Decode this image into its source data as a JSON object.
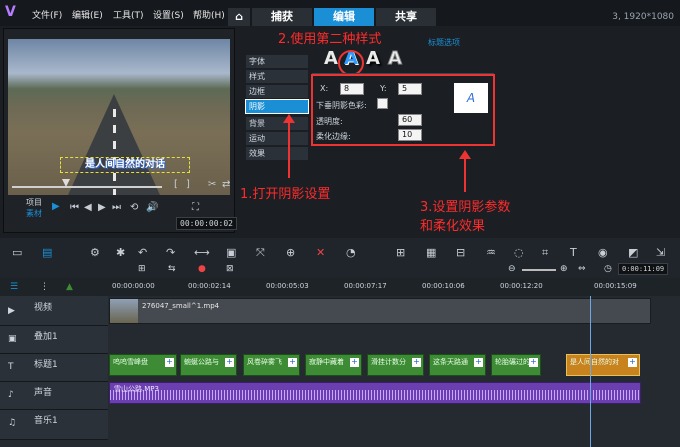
{
  "menu": {
    "items": [
      "文件(F)",
      "编辑(E)",
      "工具(T)",
      "设置(S)",
      "帮助(H)"
    ]
  },
  "tabs": {
    "home": "⌂",
    "capture": "捕获",
    "edit": "编辑",
    "share": "共享"
  },
  "resolution": "3, 1920*1080",
  "preview": {
    "subtitle": "是人间自然的对话",
    "project_label": "项目",
    "clip_label": "素材",
    "timecode": "00:00:00:02"
  },
  "title_options": {
    "header": "标题选项",
    "side_items": [
      "字体",
      "样式",
      "边框",
      "阴影",
      "背景",
      "运动",
      "效果"
    ],
    "active_item": "阴影",
    "x_label": "X:",
    "x_value": "8",
    "y_label": "Y:",
    "y_value": "5",
    "shadow_color_label": "下垂阴影色彩:",
    "opacity_label": "透明度:",
    "opacity_value": "60",
    "soft_edge_label": "柔化边缘:",
    "soft_edge_value": "10",
    "style_glyph": "A"
  },
  "annotations": {
    "step1": "1.打开阴影设置",
    "step2": "2.使用第二种样式",
    "step3_line1": "3.设置阴影参数",
    "step3_line2": "和柔化效果"
  },
  "timeline": {
    "zoom_timecode": "0:00:11:09",
    "ruler_times": [
      "00:00:00:00",
      "00:00:02:14",
      "00:00:05:03",
      "00:00:07:17",
      "00:00:10:06",
      "00:00:12:20",
      "00:00:15:09"
    ],
    "tracks": [
      {
        "name": "视频"
      },
      {
        "name": "叠加1"
      },
      {
        "name": "标题1"
      },
      {
        "name": "声音"
      },
      {
        "name": "音乐1"
      }
    ],
    "video_clip": "276047_small^1.mp4",
    "audio_clip": "雪山公路.MP3",
    "title_clips": [
      "呜呜雪峰盘",
      "蜿蜒公路与",
      "风卷碎雾飞",
      "寂静中藏着",
      "滑挂计数分",
      "这条天路通",
      "轮胎碾过的",
      "是人间自然的对"
    ]
  },
  "colors": {
    "accent": "#1b8fd6",
    "title_clip": "#3d8b34",
    "audio_clip": "#8a59c9",
    "annotation": "#ff2b2b"
  }
}
